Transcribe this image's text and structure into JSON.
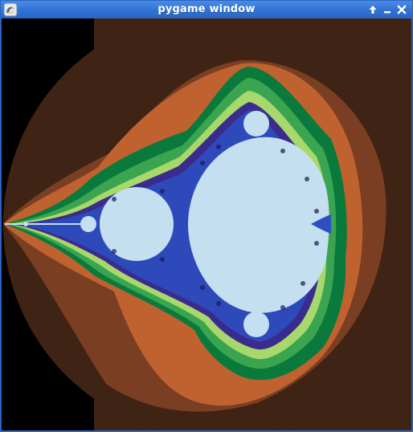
{
  "window": {
    "title": "pygame window",
    "controls": [
      {
        "name": "maximize",
        "icon": "arrow-up-icon"
      },
      {
        "name": "minimize",
        "icon": "minimize-icon"
      },
      {
        "name": "close",
        "icon": "close-icon"
      }
    ],
    "app_icon": "pygame-snake-icon"
  },
  "canvas": {
    "content": "mandelbrot-fractal",
    "colors": {
      "background_black": "#000000",
      "outer_dark_brown": "#3f2314",
      "mid_brown": "#7a3f23",
      "orange": "#c0622f",
      "green_dark": "#0a7a3c",
      "green_mid": "#3aa451",
      "green_light": "#a8d86b",
      "purple": "#3b2b8e",
      "blue": "#2d4fc2",
      "set_interior": "#c4dff0"
    }
  }
}
